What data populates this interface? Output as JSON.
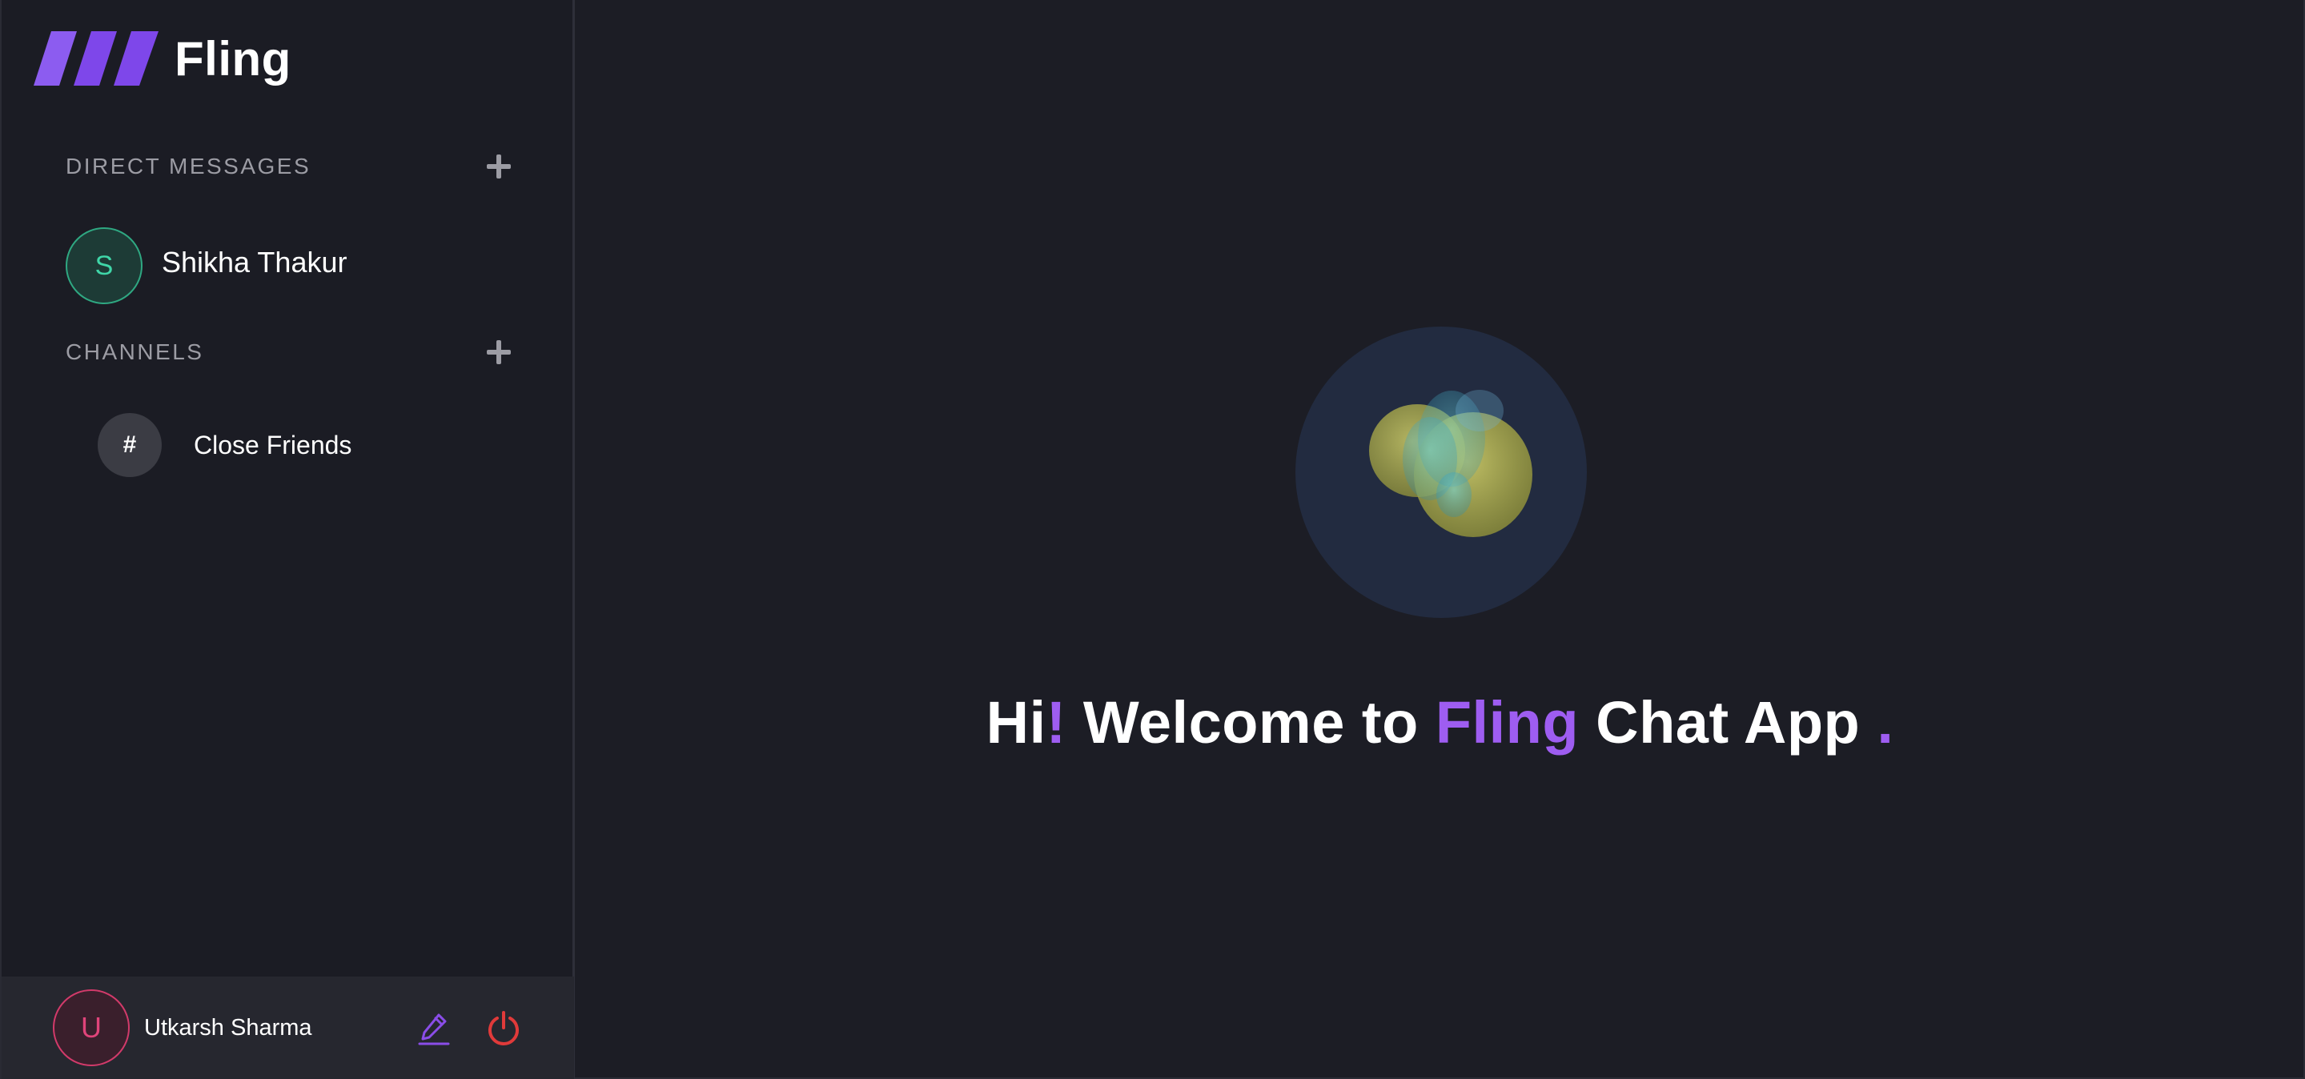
{
  "brand": {
    "name": "Fling"
  },
  "colors": {
    "accent": "#9e5df1",
    "sidebar_bg": "#1b1c24",
    "main_bg": "#1c1d25",
    "dm_avatar": "#3fd6a8",
    "user_avatar": "#e0447a",
    "power": "#e03a3a"
  },
  "sidebar": {
    "direct_messages": {
      "title": "DIRECT MESSAGES",
      "items": [
        {
          "initial": "S",
          "name": "Shikha Thakur"
        }
      ]
    },
    "channels": {
      "title": "CHANNELS",
      "items": [
        {
          "icon": "#",
          "name": "Close Friends"
        }
      ]
    }
  },
  "profile": {
    "initial": "U",
    "name": "Utkarsh Sharma",
    "icons": [
      "edit-icon",
      "power-icon"
    ]
  },
  "welcome": {
    "hi": "Hi",
    "exclaim": "!",
    "welcome_to": "Welcome to",
    "app_name": "Fling",
    "rest": "Chat App",
    "dot": "."
  }
}
